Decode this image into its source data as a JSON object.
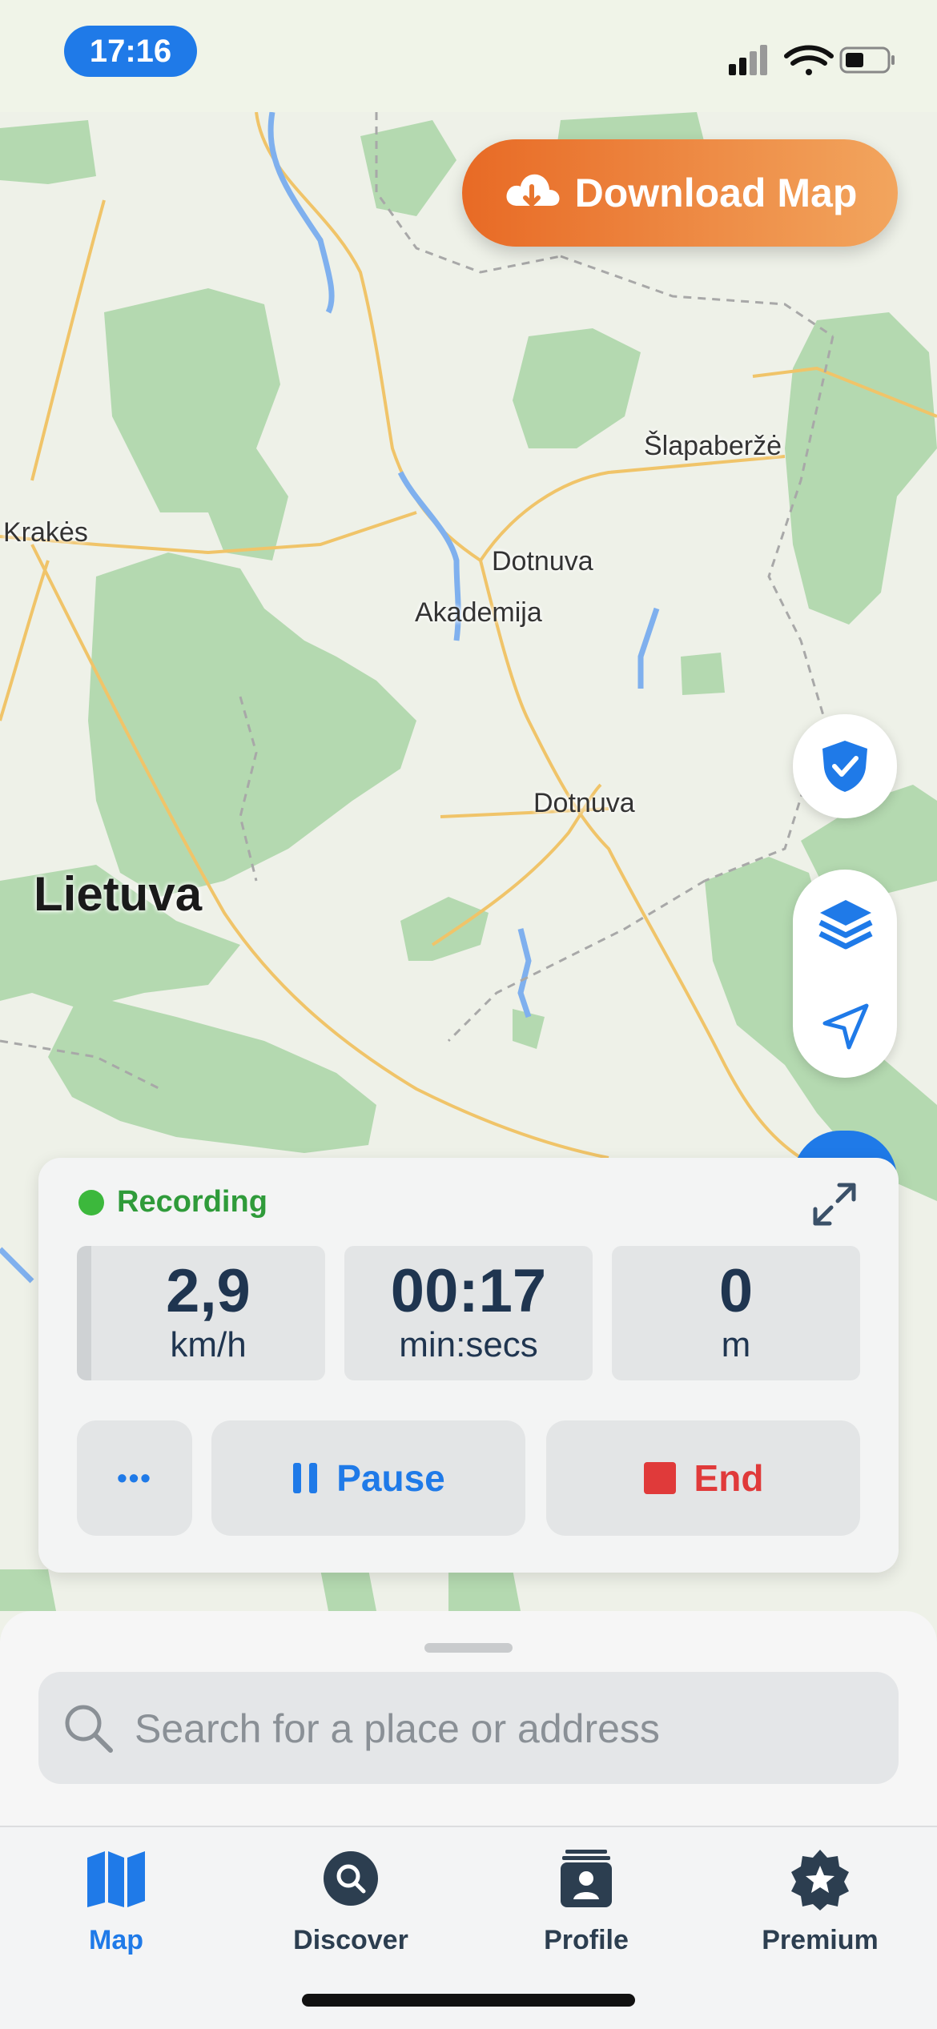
{
  "status_bar": {
    "time": "17:16"
  },
  "download_button": {
    "label": "Download Map",
    "icon": "cloud-download-icon"
  },
  "map": {
    "labels": {
      "krakes": "Krakės",
      "slapaberze": "Šlapaberžė",
      "dotnuva1": "Dotnuva",
      "akademija": "Akademija",
      "dotnuva2": "Dotnuva",
      "lietuva": "Lietuva"
    },
    "colors": {
      "forest": "#b4d9b0",
      "road": "#f0c469",
      "water": "#7fb0ee",
      "background": "#eef1e8"
    }
  },
  "fabs": {
    "shield": "shield-check-icon",
    "layers": "layers-icon",
    "locate": "location-arrow-icon"
  },
  "recording": {
    "status": "Recording",
    "stats": [
      {
        "value": "2,9",
        "unit": "km/h"
      },
      {
        "value": "00:17",
        "unit": "min:secs"
      },
      {
        "value": "0",
        "unit": "m"
      }
    ],
    "more_label": "•••",
    "pause_label": "Pause",
    "end_label": "End",
    "colors": {
      "recording_green": "#3cb83c",
      "pause_blue": "#1f7ae8",
      "end_red": "#e03a3a"
    }
  },
  "search": {
    "placeholder": "Search for a place or address"
  },
  "tabs": [
    {
      "label": "Map",
      "icon": "map-icon",
      "active": true
    },
    {
      "label": "Discover",
      "icon": "discover-icon",
      "active": false
    },
    {
      "label": "Profile",
      "icon": "profile-icon",
      "active": false
    },
    {
      "label": "Premium",
      "icon": "premium-star-icon",
      "active": false
    }
  ]
}
